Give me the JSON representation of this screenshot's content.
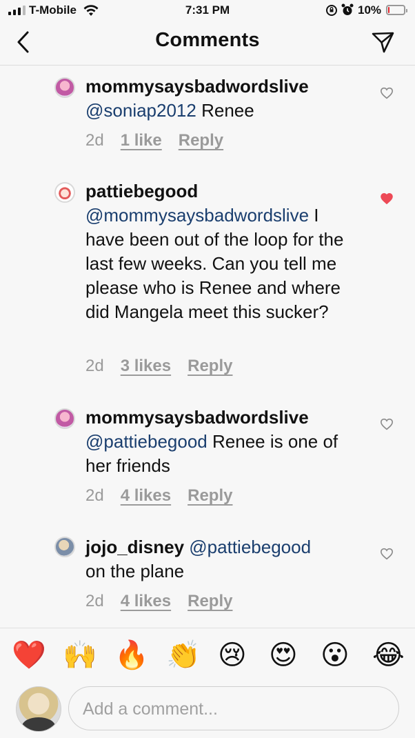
{
  "status_bar": {
    "carrier": "T-Mobile",
    "time": "7:31 PM",
    "battery": "10%",
    "battery_level": 0.1,
    "battery_color": "#e0242b"
  },
  "header": {
    "title": "Comments",
    "back_icon": "chevron-left-icon",
    "send_icon": "paper-plane-icon"
  },
  "comments": [
    {
      "username": "mommysaysbadwordslive",
      "mention": "@soniap2012",
      "text": "Renee",
      "age": "2d",
      "likes": "1 like",
      "reply": "Reply",
      "liked": false
    },
    {
      "username": "pattiebegood",
      "mention": "@mommysaysbadwordslive",
      "text": "I have been out of the loop for the last few weeks. Can you tell me please who is Renee and where did Mangela meet this sucker?",
      "age": "2d",
      "likes": "3 likes",
      "reply": "Reply",
      "liked": true
    },
    {
      "username": "mommysaysbadwordslive",
      "mention": "@pattiebegood",
      "text": "Renee is one of her friends",
      "age": "2d",
      "likes": "4 likes",
      "reply": "Reply",
      "liked": false
    },
    {
      "username": "jojo_disney",
      "mention": "@pattiebegood",
      "text": "on the plane",
      "age": "2d",
      "likes": "4 likes",
      "reply": "Reply",
      "liked": false
    }
  ],
  "emoji_bar": [
    "❤️",
    "🙌",
    "🔥",
    "👏",
    "😢",
    "😍",
    "😮",
    "😂"
  ],
  "composer": {
    "placeholder": "Add a comment..."
  },
  "colors": {
    "mention": "#1a3e6e",
    "liked_heart": "#ed4956",
    "meta": "#9a9a9a"
  }
}
